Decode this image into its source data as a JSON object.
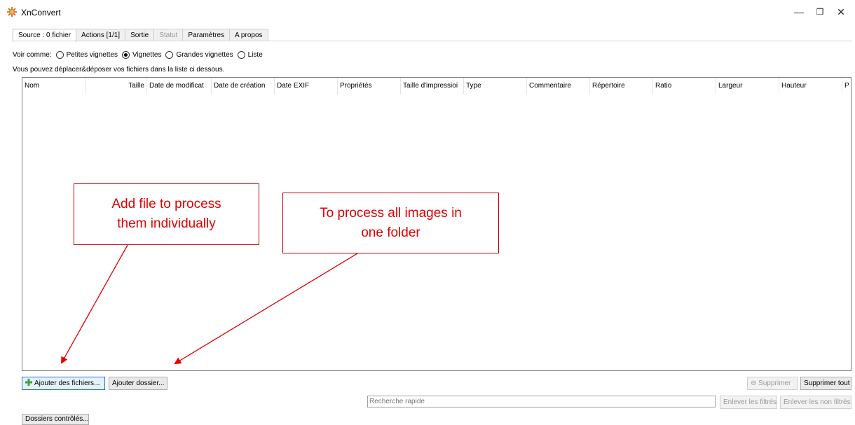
{
  "window": {
    "title": "XnConvert",
    "minimize": "—",
    "restore": "❐",
    "close": "✕"
  },
  "tabs": [
    {
      "label": "Source : 0 fichier"
    },
    {
      "label": "Actions [1/1]"
    },
    {
      "label": "Sortie"
    },
    {
      "label": "Statut"
    },
    {
      "label": "Paramètres"
    },
    {
      "label": "A propos"
    }
  ],
  "view": {
    "label": "Voir comme:",
    "options": [
      "Petites vignettes",
      "Vignettes",
      "Grandes vignettes",
      "Liste"
    ],
    "selected": "Vignettes"
  },
  "hint": "Vous pouvez déplacer&déposer vos fichiers dans la liste ci dessous.",
  "columns": [
    "Nom",
    "Taille",
    "Date de modificat",
    "Date de création",
    "Date EXIF",
    "Propriétés",
    "Taille d'impressioi",
    "Type",
    "Commentaire",
    "Répertoire",
    "Ratio",
    "Largeur",
    "Hauteur",
    "P"
  ],
  "buttons": {
    "add_files": "Ajouter des fichiers...",
    "add_folder": "Ajouter dossier...",
    "remove": "Supprimer",
    "remove_all": "Supprimer tout",
    "remove_filtered": "Enlever les filtrés",
    "remove_unfiltered": "Enlever les non filtrés",
    "watched_folders": "Dossiers contrôlés..."
  },
  "search": {
    "placeholder": "Recherche rapide"
  },
  "annotations": {
    "add_file_note": "Add file to process\nthem individually",
    "folder_note": "To process all images in\none folder",
    "color": "#e00000"
  },
  "colors": {
    "accent": "#2b6fd6",
    "annotation": "#c00000"
  }
}
